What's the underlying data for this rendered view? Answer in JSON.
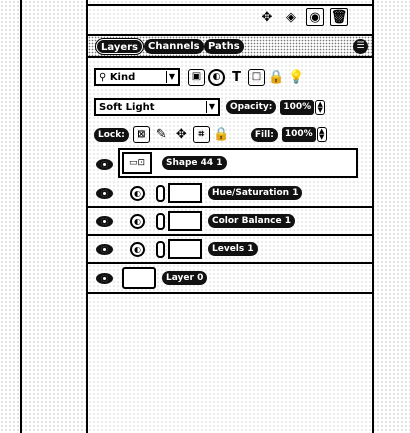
{
  "tabs": [
    {
      "label": "Layers",
      "active": true
    },
    {
      "label": "Channels",
      "active": false
    },
    {
      "label": "Paths",
      "active": false
    }
  ],
  "top_icons": [
    "move-icon",
    "fill-icon",
    "eye-icon",
    "trash-icon"
  ],
  "filter": {
    "kind_label": "Kind",
    "filter_icons": [
      "pixel-filter-icon",
      "adjustment-filter-icon",
      "type-filter-icon",
      "shape-filter-icon",
      "smart-object-filter-icon",
      "filter-toggle-icon"
    ]
  },
  "blend": {
    "mode": "Soft Light",
    "opacity_label": "Opacity:",
    "opacity_value": "100%"
  },
  "lock": {
    "label": "Lock:",
    "fill_label": "Fill:",
    "fill_value": "100%"
  },
  "layers": [
    {
      "name": "Shape 44 1",
      "type": "shape",
      "selected": true
    },
    {
      "name": "Hue/Saturation 1",
      "type": "adjustment"
    },
    {
      "name": "Color Balance 1",
      "type": "adjustment"
    },
    {
      "name": "Levels 1",
      "type": "adjustment"
    },
    {
      "name": "Layer 0",
      "type": "pixel"
    }
  ]
}
